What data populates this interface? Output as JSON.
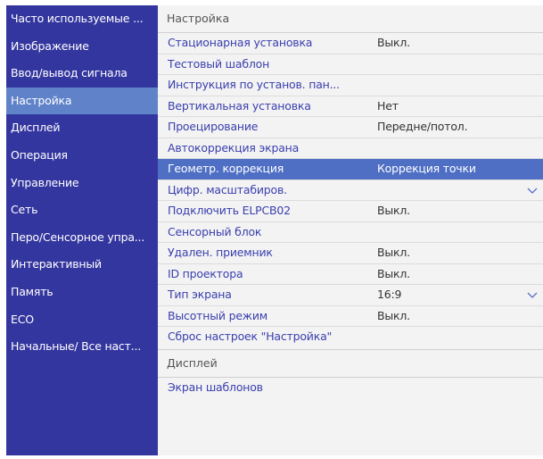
{
  "sidebar": {
    "items": [
      {
        "label": "Часто используемые ...",
        "selected": false
      },
      {
        "label": "Изображение",
        "selected": false
      },
      {
        "label": "Ввод/вывод сигнала",
        "selected": false
      },
      {
        "label": "Настройка",
        "selected": true
      },
      {
        "label": "Дисплей",
        "selected": false
      },
      {
        "label": "Операция",
        "selected": false
      },
      {
        "label": "Управление",
        "selected": false
      },
      {
        "label": "Сеть",
        "selected": false
      },
      {
        "label": "Перо/Сенсорное упра...",
        "selected": false
      },
      {
        "label": "Интерактивный",
        "selected": false
      },
      {
        "label": "Память",
        "selected": false
      },
      {
        "label": "ECO",
        "selected": false
      },
      {
        "label": "Начальные/ Все наст...",
        "selected": false
      }
    ]
  },
  "panel": {
    "section1_title": "Настройка",
    "rows": [
      {
        "label": "Стационарная установка",
        "value": "Выкл."
      },
      {
        "label": "Тестовый шаблон",
        "value": ""
      },
      {
        "label": "Инструкция по установ. пан...",
        "value": ""
      },
      {
        "label": "Вертикальная установка",
        "value": "Нет"
      },
      {
        "label": "Проецирование",
        "value": "Передне/потол."
      },
      {
        "label": "Автокоррекция экрана",
        "value": ""
      },
      {
        "label": "Геометр. коррекция",
        "value": "Коррекция точки",
        "selected": true
      },
      {
        "label": "Цифр. масштабиров.",
        "value": "",
        "chevron": true
      },
      {
        "label": "Подключить ELPCB02",
        "value": "Выкл."
      },
      {
        "label": "Сенсорный блок",
        "value": ""
      },
      {
        "label": "Удален. приемник",
        "value": "Выкл."
      },
      {
        "label": "ID проектора",
        "value": "Выкл."
      },
      {
        "label": "Тип экрана",
        "value": "16:9",
        "chevron": true
      },
      {
        "label": "Высотный режим",
        "value": "Выкл."
      },
      {
        "label": "Сброс настроек \"Настройка\"",
        "value": ""
      }
    ],
    "section2_title": "Дисплей",
    "section2_rows": [
      {
        "label": "Экран шаблонов"
      }
    ]
  },
  "colors": {
    "sidebar_bg": "#34369f",
    "sidebar_selected": "#5f82c9",
    "panel_bg": "#f3f3f3",
    "row_selected": "#4f6fc4",
    "item_text": "#3a3fae"
  },
  "icons": {
    "expand": "chevron-down-icon"
  }
}
